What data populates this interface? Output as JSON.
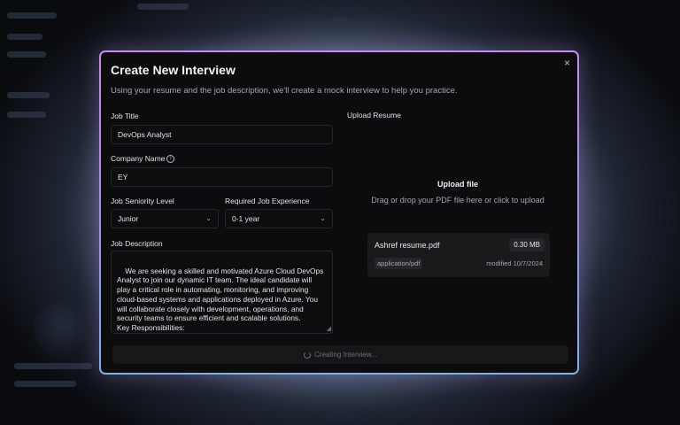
{
  "dialog": {
    "title": "Create New Interview",
    "subtitle": "Using your resume and the job description, we'll create a mock interview to help you practice.",
    "close_glyph": "×"
  },
  "form": {
    "job_title": {
      "label": "Job Title",
      "value": "DevOps Analyst"
    },
    "company_name": {
      "label": "Company Name",
      "value": "EY"
    },
    "seniority": {
      "label": "Job Seniority Level",
      "value": "Junior"
    },
    "experience": {
      "label": "Required Job Experience",
      "value": "0-1 year"
    },
    "description": {
      "label": "Job Description",
      "value": "We are seeking a skilled and motivated Azure Cloud DevOps Analyst to join our dynamic IT team. The ideal candidate will play a critical role in automating, monitoring, and improving cloud-based systems and applications deployed in Azure. You will collaborate closely with development, operations, and security teams to ensure efficient and scalable solutions.\nKey Responsibilities:"
    }
  },
  "upload": {
    "label": "Upload Resume",
    "title": "Upload file",
    "hint": "Drag or drop your PDF file here or click to upload",
    "file": {
      "name": "Ashref resume.pdf",
      "size": "0.30 MB",
      "type": "application/pdf",
      "modified": "modified 10/7/2024"
    }
  },
  "submit": {
    "label": "Creating Interview..."
  },
  "icons": {
    "close": "close-icon",
    "info": "info-icon",
    "chevron": "chevron-down-icon",
    "spinner": "spinner-icon",
    "resize": "resize-handle-icon"
  },
  "colors": {
    "modal_border_top": "#c98be6",
    "modal_border_bottom": "#7fb0e6",
    "modal_bg": "#0c0c0e"
  }
}
